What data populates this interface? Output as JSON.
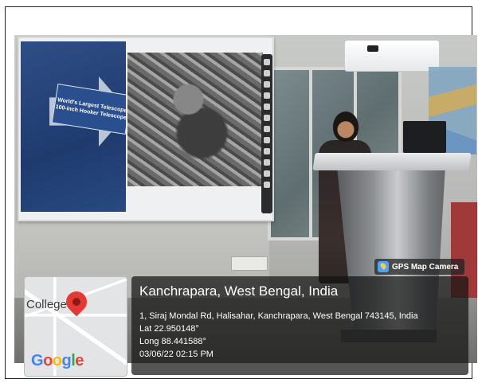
{
  "slide": {
    "arrow_text": "World's Largest Telescope 100-inch Hooker Telescope"
  },
  "overlay": {
    "badge_label": "GPS Map Camera",
    "map_label": "College",
    "map_brand": "Google",
    "place": "Kanchrapara, West Bengal, India",
    "address": "1, Siraj Mondal Rd, Halisahar, Kanchrapara, West Bengal 743145, India",
    "lat": "Lat 22.950148°",
    "long": "Long 88.441588°",
    "datetime": "03/06/22 02:15 PM"
  },
  "icons": {
    "badge_icon": "gps-map-camera-icon",
    "map_pin": "map-pin-icon"
  },
  "colors": {
    "pin": "#e53935",
    "panel": "#141414"
  }
}
